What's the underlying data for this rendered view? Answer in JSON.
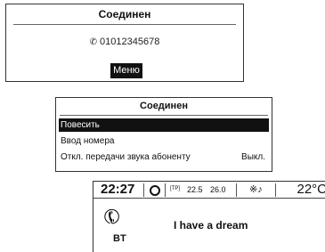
{
  "connected_screen": {
    "title": "Соединен",
    "phone_number": "01012345678",
    "menu_label": "Меню"
  },
  "connected_menu": {
    "title": "Соединен",
    "items": [
      {
        "label": "Повесить",
        "value": ""
      },
      {
        "label": "Ввод номера",
        "value": ""
      },
      {
        "label": "Откл. передачи звука абоненту",
        "value": "Выкл."
      }
    ],
    "selected_index": 0
  },
  "info_display": {
    "time": "22:27",
    "tp_label": "[TP]",
    "temp_a": "22.5",
    "temp_b": "26.0",
    "outside_temp": "22°C",
    "source_label": "BT",
    "caller_text": "I have a dream",
    "icons": [
      "radio-icon",
      "bluetooth-icon",
      "music-icon",
      "handset-icon"
    ]
  }
}
